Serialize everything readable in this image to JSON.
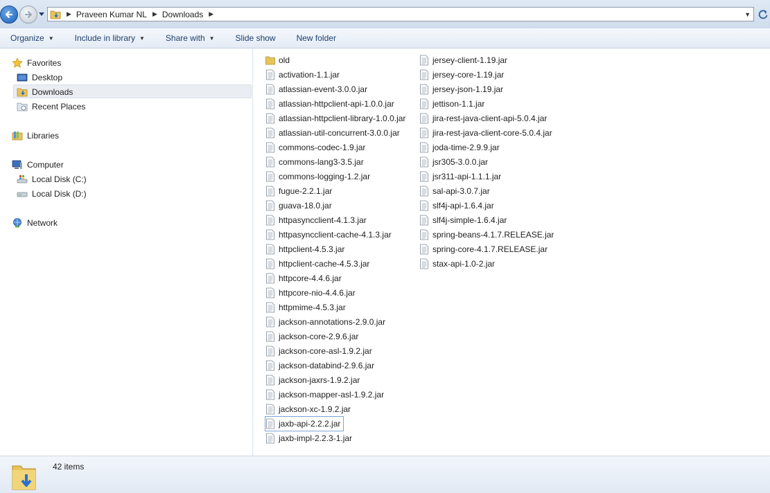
{
  "address": {
    "breadcrumbs": [
      "Praveen Kumar NL",
      "Downloads"
    ]
  },
  "toolbar": {
    "organize": "Organize",
    "include_in_library": "Include in library",
    "share_with": "Share with",
    "slide_show": "Slide show",
    "new_folder": "New folder"
  },
  "nav": {
    "favorites": "Favorites",
    "desktop": "Desktop",
    "downloads": "Downloads",
    "recent_places": "Recent Places",
    "libraries": "Libraries",
    "computer": "Computer",
    "local_disk_c": "Local Disk (C:)",
    "local_disk_d": "Local Disk (D:)",
    "network": "Network"
  },
  "files": {
    "column1": [
      "old",
      "activation-1.1.jar",
      "atlassian-event-3.0.0.jar",
      "atlassian-httpclient-api-1.0.0.jar",
      "atlassian-httpclient-library-1.0.0.jar",
      "atlassian-util-concurrent-3.0.0.jar",
      "commons-codec-1.9.jar",
      "commons-lang3-3.5.jar",
      "commons-logging-1.2.jar",
      "fugue-2.2.1.jar",
      "guava-18.0.jar",
      "httpasyncclient-4.1.3.jar",
      "httpasyncclient-cache-4.1.3.jar",
      "httpclient-4.5.3.jar",
      "httpclient-cache-4.5.3.jar",
      "httpcore-4.4.6.jar",
      "httpcore-nio-4.4.6.jar",
      "httpmime-4.5.3.jar",
      "jackson-annotations-2.9.0.jar",
      "jackson-core-2.9.6.jar",
      "jackson-core-asl-1.9.2.jar",
      "jackson-databind-2.9.6.jar",
      "jackson-jaxrs-1.9.2.jar",
      "jackson-mapper-asl-1.9.2.jar",
      "jackson-xc-1.9.2.jar",
      "jaxb-api-2.2.2.jar",
      "jaxb-impl-2.2.3-1.jar"
    ],
    "column2": [
      "jersey-client-1.19.jar",
      "jersey-core-1.19.jar",
      "jersey-json-1.19.jar",
      "jettison-1.1.jar",
      "jira-rest-java-client-api-5.0.4.jar",
      "jira-rest-java-client-core-5.0.4.jar",
      "joda-time-2.9.9.jar",
      "jsr305-3.0.0.jar",
      "jsr311-api-1.1.1.jar",
      "sal-api-3.0.7.jar",
      "slf4j-api-1.6.4.jar",
      "slf4j-simple-1.6.4.jar",
      "spring-beans-4.1.7.RELEASE.jar",
      "spring-core-4.1.7.RELEASE.jar",
      "stax-api-1.0-2.jar"
    ]
  },
  "status": {
    "item_count": "42 items"
  },
  "icons": {
    "back": "back-arrow-icon",
    "forward": "forward-arrow-icon",
    "folder": "folder-icon",
    "jar": "jar-file-icon"
  }
}
